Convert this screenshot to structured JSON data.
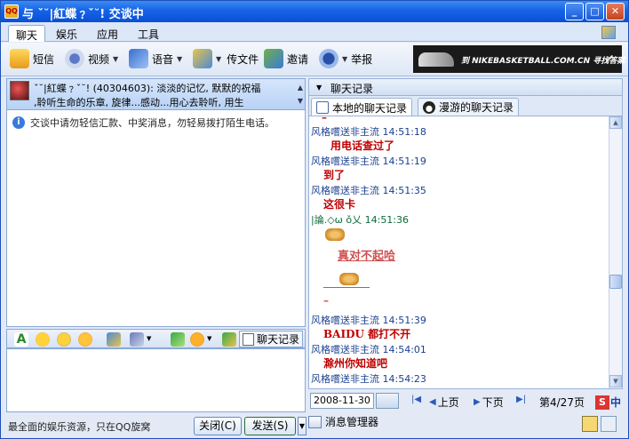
{
  "window": {
    "app_icon": "QQ",
    "title": "与 ˇ˘|紅蝶﹖ˇ˘! 交谈中"
  },
  "menu_tabs": [
    "聊天",
    "娱乐",
    "应用",
    "工具"
  ],
  "toolbar": {
    "sms": "短信",
    "video": "视频",
    "voice": "语音",
    "send_file": "传文件",
    "invite": "邀请",
    "report": "举报"
  },
  "ad": {
    "text": "到 NIKEBASKETBALL.COM.CN 寻找答案",
    "logo": "✓"
  },
  "contact": {
    "sig_line1": "ˇ˘|紅蝶﹖ˇ˘! (40304603): 淡淡的记忆, 默默的祝福",
    "sig_line2": ",聆听生命的乐章, 旋律...感动...用心去聆听, 用生"
  },
  "notice": "交谈中请勿轻信汇款、中奖消息，勿轻易拨打陌生电话。",
  "input_toolbar": {
    "history": "聊天记录"
  },
  "status_text": "最全面的娱乐资源，只在QQ旋窝",
  "buttons": {
    "close": "关闭(C)",
    "send": "发送(S)"
  },
  "history_panel": {
    "header": "聊天记录",
    "tab_local": "本地的聊天记录",
    "tab_roaming": "漫游的聊天记录"
  },
  "messages": [
    {
      "sender": "风格嚐送非主流",
      "time": "14:51:18",
      "text": "用电话查过了"
    },
    {
      "sender": "风格嚐送非主流",
      "time": "14:51:19",
      "text": "到了"
    },
    {
      "sender": "风格嚐送非主流",
      "time": "14:51:35",
      "text": "这很卡"
    },
    {
      "sender": "|論.◇ω ǒ乂",
      "time": "14:51:36",
      "text": "真对不起哈"
    },
    {
      "sender": "风格嚐送非主流",
      "time": "14:51:39",
      "text": "BAIDU 都打不开"
    },
    {
      "sender": "风格嚐送非主流",
      "time": "14:54:01",
      "text": "滁州你知道吧"
    },
    {
      "sender": "风格嚐送非主流",
      "time": "14:54:23",
      "text": ""
    }
  ],
  "nav": {
    "date": "2008-11-30",
    "prev": "上页",
    "next": "下页",
    "page": "第4/27页"
  },
  "ime": {
    "label": "中"
  },
  "msg_manager": "消息管理器"
}
